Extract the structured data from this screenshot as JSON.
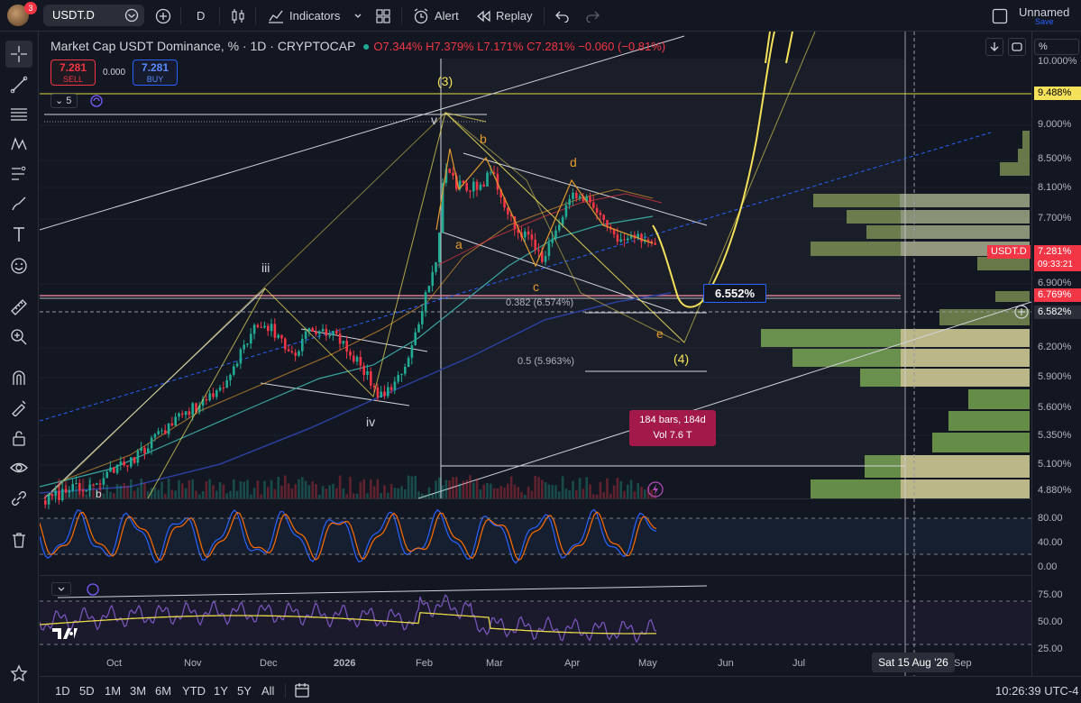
{
  "toolbar": {
    "notification_count": "3",
    "symbol": "USDT.D",
    "interval": "D",
    "indicators": "Indicators",
    "alert": "Alert",
    "replay": "Replay",
    "layout_name": "Unnamed",
    "save": "Save"
  },
  "legend": {
    "title": "Market Cap USDT Dominance, % · 1D · CRYPTOCAP",
    "ohlc": "O7.344% H7.379% L7.171% C7.281% −0.060 (−0.81%)",
    "sell_price": "7.281",
    "sell_label": "SELL",
    "spread": "0.000",
    "buy_price": "7.281",
    "buy_label": "BUY",
    "collapsed_count": "5"
  },
  "price_scale": {
    "unit": "%",
    "ticks": [
      "10.000%",
      "9.000%",
      "8.500%",
      "8.100%",
      "7.700%",
      "6.900%",
      "6.200%",
      "5.900%",
      "5.600%",
      "5.350%",
      "5.100%",
      "4.880%"
    ],
    "labels": {
      "level_line": "9.488%",
      "symbol_tag": "USDT.D",
      "last_price": "7.281%",
      "countdown": "09:33:21",
      "support_line": "6.769%",
      "crosshair": "6.582%"
    }
  },
  "osc_scale": {
    "stoch": [
      "80.00",
      "40.00",
      "0.00"
    ],
    "rsi": [
      "75.00",
      "50.00",
      "25.00"
    ]
  },
  "annotations": {
    "wave_3": "(3)",
    "wave_4": "(4)",
    "wave_b": "b",
    "wave_d": "d",
    "wave_a": "a",
    "wave_c": "c",
    "wave_e": "e",
    "wave_iii": "iii",
    "wave_iv": "iv",
    "wave_v": "v",
    "wave_b_small": "b",
    "fib_382": "0.382 (6.574%)",
    "fib_5": "0.5 (5.963%)",
    "target_pct": "6.552%",
    "range_bars": "184 bars, 184d",
    "range_vol": "Vol 7.6 T"
  },
  "time_axis": {
    "labels": [
      "Oct",
      "Nov",
      "Dec",
      "2026",
      "Feb",
      "Mar",
      "Apr",
      "May",
      "Jun",
      "Jul",
      "Sep"
    ],
    "crosshair_date": "Sat 15 Aug '26"
  },
  "bottom": {
    "ranges": [
      "1D",
      "5D",
      "1M",
      "3M",
      "6M",
      "YTD",
      "1Y",
      "5Y",
      "All"
    ],
    "clock": "10:26:39 UTC-4"
  },
  "colors": {
    "bg": "#131722",
    "up": "#22ab94",
    "down": "#f23645",
    "wave_yellow": "#f5e25a",
    "orange": "#e49a2c",
    "accent": "#2962ff"
  }
}
